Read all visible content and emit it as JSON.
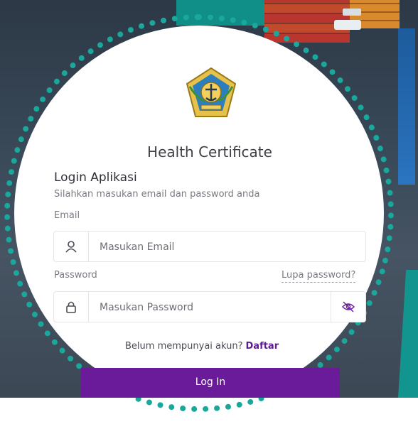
{
  "app": {
    "title": "Health Certificate"
  },
  "login": {
    "heading": "Login Aplikasi",
    "subtitle": "Silahkan masukan email dan password anda"
  },
  "email": {
    "label": "Email",
    "placeholder": "Masukan Email",
    "icon": "user-icon"
  },
  "password": {
    "label": "Password",
    "placeholder": "Masukan Password",
    "forgot_label": "Lupa password?",
    "icon": "lock-icon",
    "toggle_icon": "eye-slash-icon"
  },
  "register": {
    "prompt": "Belum mempunyai akun?",
    "link_label": "Daftar"
  },
  "submit": {
    "label": "Log In"
  },
  "colors": {
    "accent": "#6a1b9a",
    "teal": "#1aa79c",
    "link": "#5d1b93"
  }
}
